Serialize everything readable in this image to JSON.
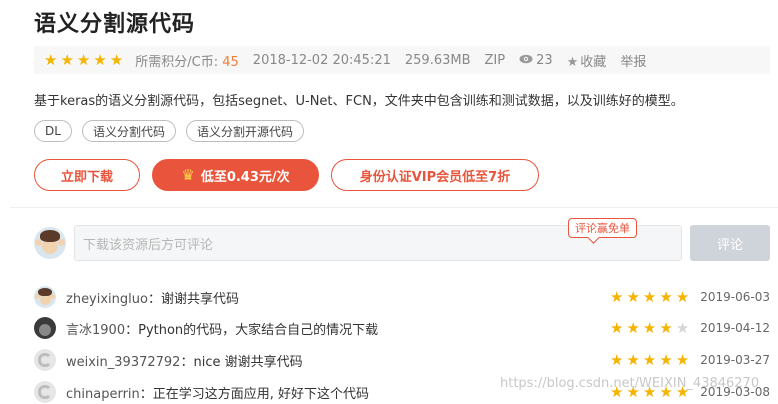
{
  "resource": {
    "title": "语义分割源代码",
    "rating_stars": 5,
    "points_label": "所需积分/C币:",
    "points_value": "45",
    "date": "2018-12-02 20:45:21",
    "size": "259.63MB",
    "format": "ZIP",
    "views": "23",
    "favorite_label": "收藏",
    "report_label": "举报",
    "description": "基于keras的语义分割源代码，包括segnet、U-Net、FCN，文件夹中包含训练和测试数据，以及训练好的模型。",
    "tags": [
      "DL",
      "语义分割代码",
      "语义分割开源代码"
    ]
  },
  "actions": {
    "download_label": "立即下载",
    "vip_price_label": "低至0.43元/次",
    "vip_member_label": "身份认证VIP会员低至7折"
  },
  "comment_box": {
    "placeholder": "下载该资源后方可评论",
    "promo_label": "评论赢免单",
    "submit_label": "评论"
  },
  "comments": [
    {
      "user": "zheyixingluo",
      "text": "谢谢共享代码",
      "stars": 5,
      "date": "2019-06-03"
    },
    {
      "user": "言冰1900",
      "text": "Python的代码，大家结合自己的情况下载",
      "stars": 4,
      "date": "2019-04-12"
    },
    {
      "user": "weixin_39372792",
      "text": "nice 谢谢共享代码",
      "stars": 5,
      "date": "2019-03-27"
    },
    {
      "user": "chinaperrin",
      "text": "正在学习这方面应用, 好好下这个代码",
      "stars": 5,
      "date": "2019-03-08"
    }
  ],
  "watermark": "https://blog.csdn.net/WEIXIN_43846270",
  "colors": {
    "accent": "#e8553c",
    "star": "#f5b400",
    "points": "#f07e3a"
  },
  "icons": {
    "star": "star-icon",
    "eye": "eye-icon",
    "favorite": "star-outline-icon",
    "crown": "crown-icon"
  }
}
